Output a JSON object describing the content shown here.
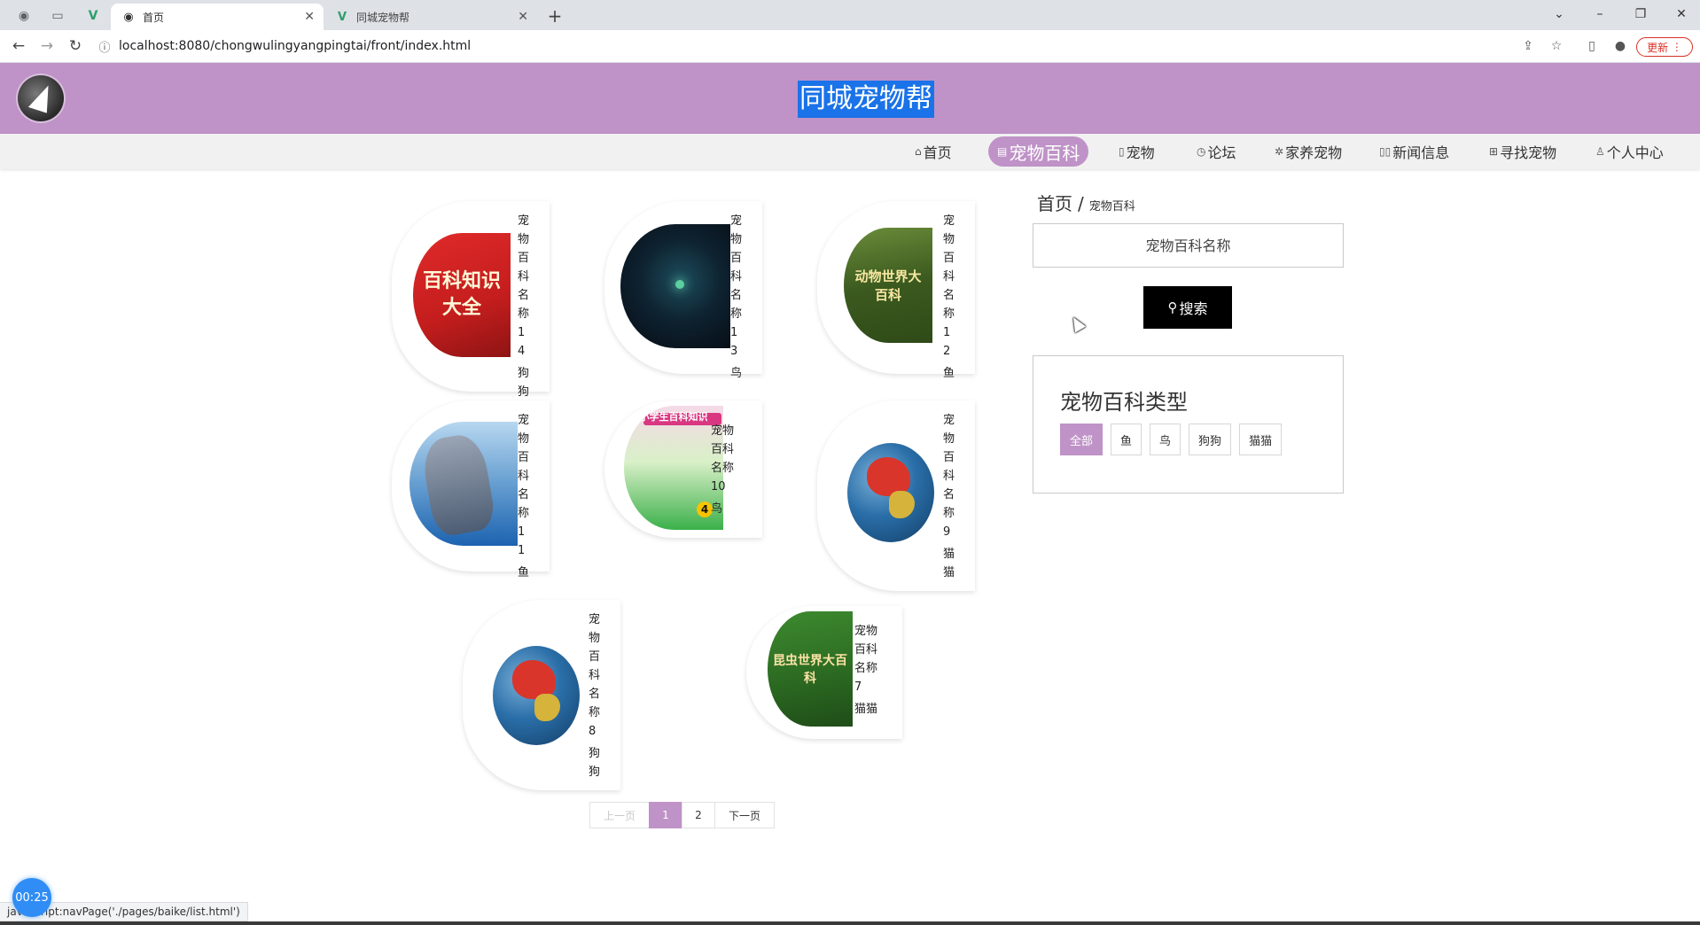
{
  "browser": {
    "tabs": [
      {
        "label": "首页",
        "active": true
      },
      {
        "label": "同城宠物帮",
        "active": false
      }
    ],
    "url": "localhost:8080/chongwulingyangpingtai/front/index.html",
    "update_label": "更新",
    "status_url": "javascript:navPage('./pages/baike/list.html')"
  },
  "header": {
    "title": "同城宠物帮"
  },
  "nav": {
    "items": [
      {
        "label": "首页",
        "icon": "home-icon"
      },
      {
        "label": "宠物百科",
        "icon": "book-icon",
        "active": true
      },
      {
        "label": "宠物",
        "icon": "note-icon"
      },
      {
        "label": "论坛",
        "icon": "clock-icon"
      },
      {
        "label": "家养宠物",
        "icon": "gear-icon"
      },
      {
        "label": "新闻信息",
        "icon": "news-icon"
      },
      {
        "label": "寻找宠物",
        "icon": "grid-icon"
      },
      {
        "label": "个人中心",
        "icon": "user-icon"
      }
    ]
  },
  "cards": [
    {
      "name": "宠物百科名称14",
      "type": "狗狗",
      "image": "百科知识大全"
    },
    {
      "name": "宠物百科名称13",
      "type": "鸟",
      "image": ""
    },
    {
      "name": "宠物百科名称12",
      "type": "鱼",
      "image": "动物世界大百科"
    },
    {
      "name": "宠物百科名称11",
      "type": "鱼",
      "image": ""
    },
    {
      "name": "宠物百科名称10",
      "type": "鸟",
      "image": "小学生百科知识"
    },
    {
      "name": "宠物百科名称9",
      "type": "猫猫",
      "image": ""
    },
    {
      "name": "宠物百科名称8",
      "type": "狗狗",
      "image": ""
    },
    {
      "name": "宠物百科名称7",
      "type": "猫猫",
      "image": "昆虫世界大百科"
    }
  ],
  "breadcrumb": {
    "home": "首页",
    "separator": "/",
    "current": "宠物百科"
  },
  "search": {
    "placeholder": "宠物百科名称",
    "button_label": "搜索"
  },
  "types": {
    "title": "宠物百科类型",
    "options": [
      {
        "label": "全部",
        "active": true
      },
      {
        "label": "鱼",
        "active": false
      },
      {
        "label": "鸟",
        "active": false
      },
      {
        "label": "狗狗",
        "active": false
      },
      {
        "label": "猫猫",
        "active": false
      }
    ]
  },
  "pagination": {
    "prev": "上一页",
    "pages": [
      "1",
      "2"
    ],
    "current": "1",
    "next": "下一页"
  },
  "recorder": {
    "time": "00:25"
  },
  "colors": {
    "brand": "#bf93c7",
    "search_button": "#000000"
  }
}
